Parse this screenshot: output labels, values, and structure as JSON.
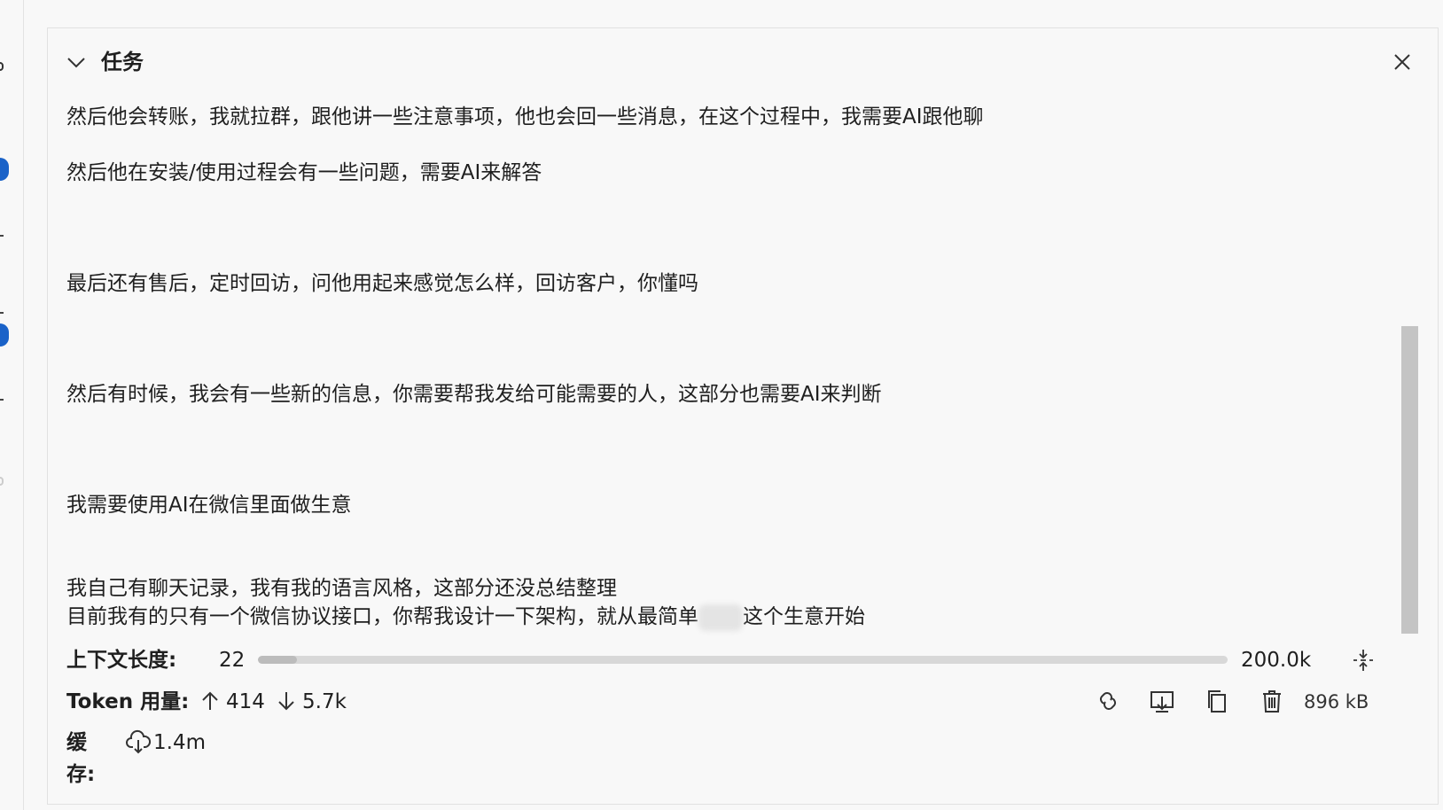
{
  "panel": {
    "title": "任务",
    "task_lines": [
      "然后他会转账，我就拉群，跟他讲一些注意事项，他也会回一些消息，在这个过程中，我需要AI跟他聊",
      "然后他在安装/使用过程会有一些问题，需要AI来解答",
      "最后还有售后，定时回访，问他用起来感觉怎么样，回访客户，你懂吗",
      "然后有时候，我会有一些新的信息，你需要帮我发给可能需要的人，这部分也需要AI来判断",
      "我需要使用AI在微信里面做生意",
      "我自己有聊天记录，我有我的语言风格，这部分还没总结整理",
      "目前我有的只有一个微信协议接口，你帮我设计一下架构，就从最简单",
      "这个生意开始"
    ]
  },
  "context": {
    "label": "上下文长度:",
    "current": "22",
    "max": "200.0k",
    "fill_fraction": 0.04
  },
  "tokens": {
    "label": "Token 用量:",
    "input": "414",
    "output": "5.7k",
    "size": "896 kB"
  },
  "cache": {
    "label": "缓存:",
    "value": "1.4m"
  },
  "icons": {
    "collapse": "chevron-down-icon",
    "close": "close-icon",
    "condense": "condense-icon",
    "share": "link-icon",
    "export": "export-icon",
    "copy": "copy-icon",
    "delete": "trash-icon",
    "cache": "cloud-download-icon"
  },
  "colors": {
    "panel_bg": "#f8f8f8",
    "scrollbar": "#c4c4c4",
    "badge_blue": "#1a62c8",
    "text": "#1f1f1f"
  }
}
